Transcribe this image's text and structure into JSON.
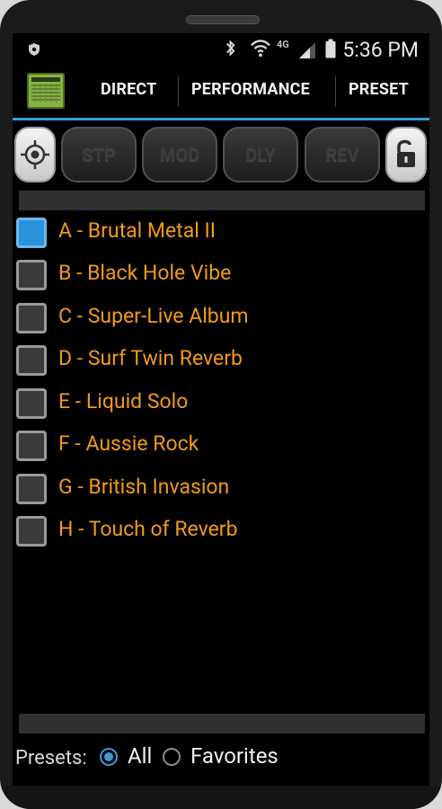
{
  "status_bar": {
    "time": "5:36 PM",
    "network": "4G",
    "icons": [
      "shield-icon",
      "bluetooth-icon",
      "wifi-icon",
      "signal-icon",
      "battery-icon"
    ]
  },
  "header": {
    "tabs": [
      {
        "label": "DIRECT"
      },
      {
        "label": "PERFORMANCE"
      },
      {
        "label": "PRESET"
      }
    ]
  },
  "effects": {
    "buttons": [
      {
        "label": "STP"
      },
      {
        "label": "MOD"
      },
      {
        "label": "DLY"
      },
      {
        "label": "REV"
      }
    ]
  },
  "presets": {
    "items": [
      {
        "label": "A - Brutal Metal II",
        "selected": true
      },
      {
        "label": "B - Black Hole Vibe",
        "selected": false
      },
      {
        "label": "C - Super-Live Album",
        "selected": false
      },
      {
        "label": "D - Surf Twin Reverb",
        "selected": false
      },
      {
        "label": "E - Liquid Solo",
        "selected": false
      },
      {
        "label": "F - Aussie Rock",
        "selected": false
      },
      {
        "label": "G - British Invasion",
        "selected": false
      },
      {
        "label": "H - Touch of Reverb",
        "selected": false
      }
    ]
  },
  "filter": {
    "label": "Presets:",
    "options": [
      {
        "label": "All",
        "selected": true
      },
      {
        "label": "Favorites",
        "selected": false
      }
    ]
  },
  "colors": {
    "accent": "#3d9ad6",
    "preset_text": "#f19a1a",
    "logo": "#86b441"
  }
}
